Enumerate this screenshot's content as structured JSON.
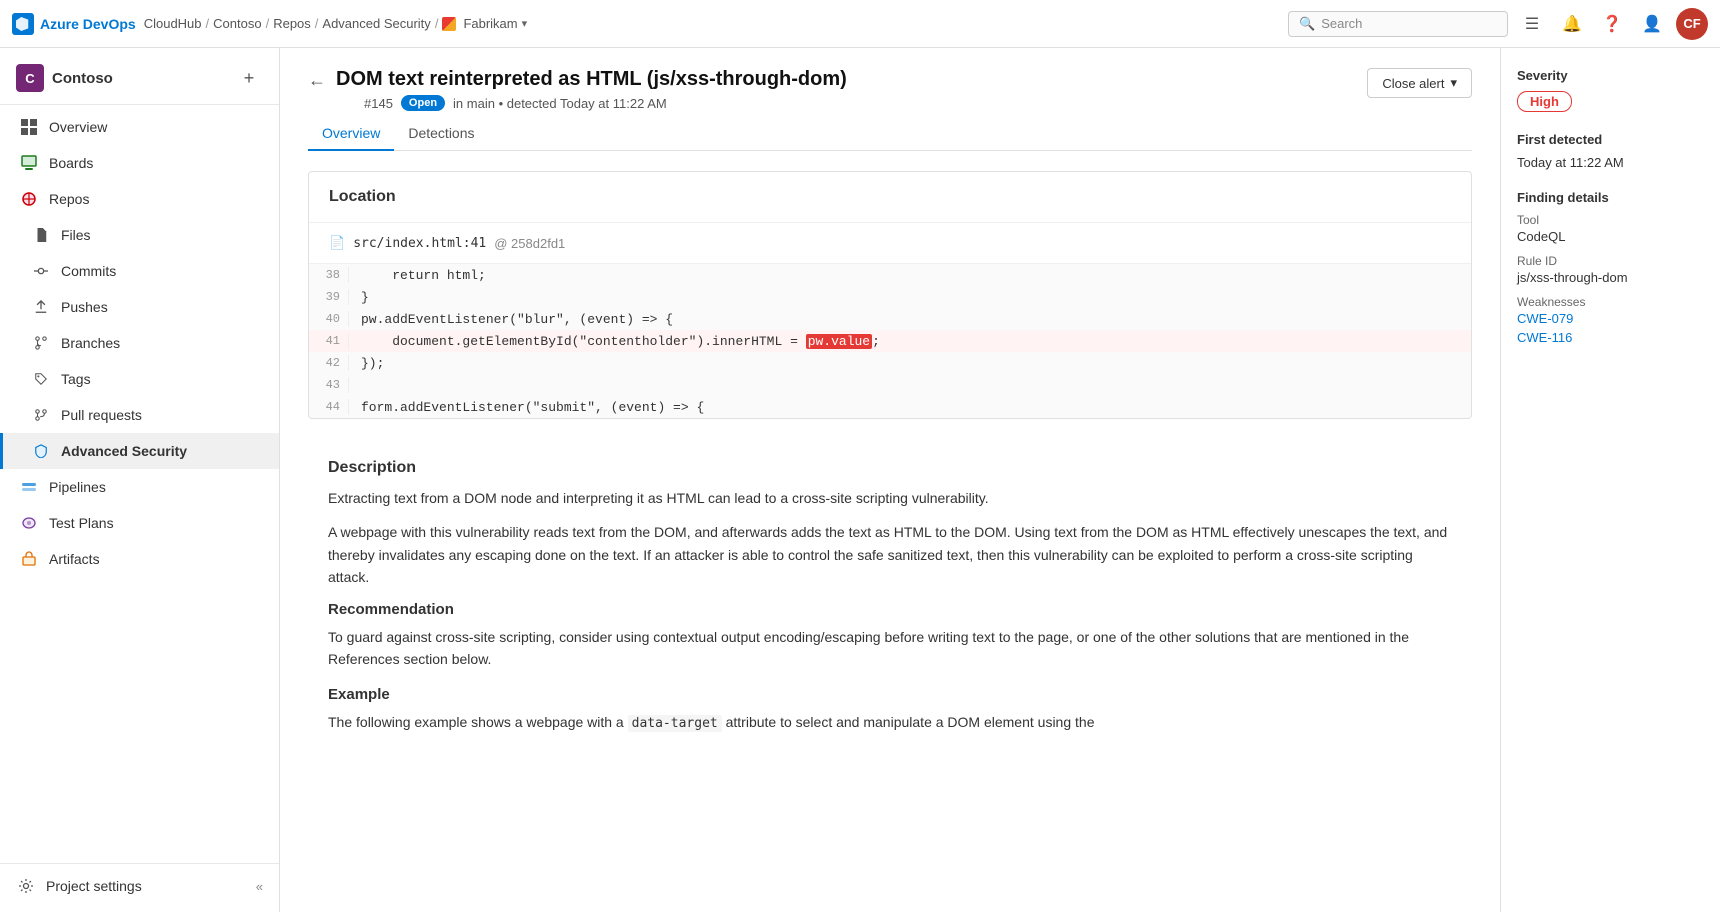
{
  "topnav": {
    "logo_text": "Azure DevOps",
    "breadcrumbs": [
      "CloudHub",
      "Contoso",
      "Repos",
      "Advanced Security",
      "Fabrikam"
    ],
    "search_placeholder": "Search",
    "avatar_initials": "CF"
  },
  "sidebar": {
    "org_name": "Contoso",
    "org_initial": "C",
    "items": [
      {
        "id": "overview",
        "label": "Overview",
        "icon": "grid"
      },
      {
        "id": "boards",
        "label": "Boards",
        "icon": "boards"
      },
      {
        "id": "repos",
        "label": "Repos",
        "icon": "repos"
      },
      {
        "id": "files",
        "label": "Files",
        "icon": "files"
      },
      {
        "id": "commits",
        "label": "Commits",
        "icon": "commits"
      },
      {
        "id": "pushes",
        "label": "Pushes",
        "icon": "pushes"
      },
      {
        "id": "branches",
        "label": "Branches",
        "icon": "branches"
      },
      {
        "id": "tags",
        "label": "Tags",
        "icon": "tags"
      },
      {
        "id": "pull-requests",
        "label": "Pull requests",
        "icon": "pullrequests"
      },
      {
        "id": "advanced-security",
        "label": "Advanced Security",
        "icon": "shield",
        "active": true
      },
      {
        "id": "pipelines",
        "label": "Pipelines",
        "icon": "pipelines"
      },
      {
        "id": "test-plans",
        "label": "Test Plans",
        "icon": "testplans"
      },
      {
        "id": "artifacts",
        "label": "Artifacts",
        "icon": "artifacts"
      }
    ],
    "bottom": {
      "project_settings": "Project settings"
    }
  },
  "page": {
    "title": "DOM text reinterpreted as HTML (js/xss-through-dom)",
    "issue_number": "#145",
    "status_badge": "Open",
    "location_info": "in main • detected Today at 11:22 AM",
    "close_alert_label": "Close alert",
    "tabs": [
      "Overview",
      "Detections"
    ],
    "active_tab": "Overview"
  },
  "location_section": {
    "title": "Location",
    "file_path": "src/index.html:41",
    "file_hash": "@ 258d2fd1",
    "code_lines": [
      {
        "number": "38",
        "code": "    return html;",
        "highlight": false
      },
      {
        "number": "39",
        "code": "}",
        "highlight": false
      },
      {
        "number": "40",
        "code": "pw.addEventListener(\"blur\", (event) => {",
        "highlight": false
      },
      {
        "number": "41",
        "code": "    document.getElementById(\"contentholder\").innerHTML = ",
        "highlight": true,
        "highlight_code": "pw.value",
        "after_code": ";"
      },
      {
        "number": "42",
        "code": "});",
        "highlight": false
      },
      {
        "number": "43",
        "code": "",
        "highlight": false
      },
      {
        "number": "44",
        "code": "form.addEventListener(\"submit\", (event) => {",
        "highlight": false
      }
    ]
  },
  "description_section": {
    "title": "Description",
    "paragraphs": [
      "Extracting text from a DOM node and interpreting it as HTML can lead to a cross-site scripting vulnerability.",
      "A webpage with this vulnerability reads text from the DOM, and afterwards adds the text as HTML to the DOM. Using text from the DOM as HTML effectively unescapes the text, and thereby invalidates any escaping done on the text. If an attacker is able to control the safe sanitized text, then this vulnerability can be exploited to perform a cross-site scripting attack."
    ],
    "recommendation_title": "Recommendation",
    "recommendation_text": "To guard against cross-site scripting, consider using contextual output encoding/escaping before writing text to the page, or one of the other solutions that are mentioned in the References section below.",
    "example_title": "Example",
    "example_text": "The following example shows a webpage with a data-target attribute to select and manipulate a DOM element using the"
  },
  "right_panel": {
    "severity_label": "Severity",
    "severity_value": "High",
    "first_detected_label": "First detected",
    "first_detected_value": "Today at 11:22 AM",
    "finding_details_label": "Finding details",
    "tool_label": "Tool",
    "tool_value": "CodeQL",
    "rule_id_label": "Rule ID",
    "rule_id_value": "js/xss-through-dom",
    "weaknesses_label": "Weaknesses",
    "weaknesses": [
      "CWE-079",
      "CWE-116"
    ]
  }
}
